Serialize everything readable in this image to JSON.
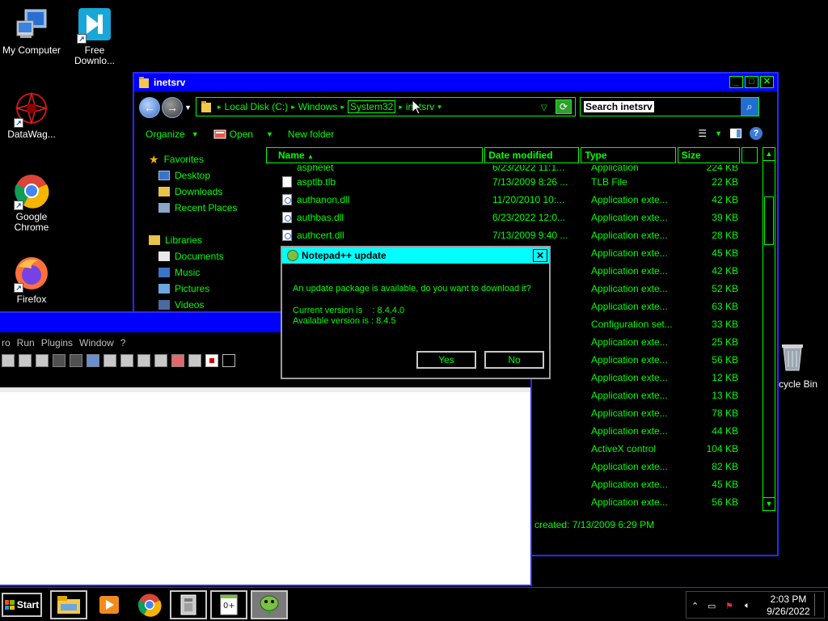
{
  "desktop": {
    "icons": [
      {
        "label": "My Computer"
      },
      {
        "label": "Free Downlo..."
      },
      {
        "label": "DataWag..."
      },
      {
        "label": "Google Chrome"
      },
      {
        "label": "Firefox"
      },
      {
        "label": "cycle Bin"
      }
    ]
  },
  "explorer": {
    "title": "inetsrv",
    "breadcrumbs": [
      "Local Disk (C:)",
      "Windows",
      "System32",
      "inetsrv"
    ],
    "search_placeholder": "Search inetsrv",
    "commands": {
      "organize": "Organize",
      "open": "Open",
      "new_folder": "New folder"
    },
    "nav": {
      "favorites": "Favorites",
      "desktop": "Desktop",
      "downloads": "Downloads",
      "recent": "Recent Places",
      "libraries": "Libraries",
      "documents": "Documents",
      "music": "Music",
      "pictures": "Pictures",
      "videos": "Videos"
    },
    "columns": {
      "name": "Name",
      "date": "Date modified",
      "type": "Type",
      "size": "Size"
    },
    "partial_row": {
      "name": "asphelet",
      "date": "6/23/2022 11:1...",
      "type": "Application",
      "size": "224 KB"
    },
    "files": [
      {
        "name": "asptlb.tlb",
        "date": "7/13/2009 8:26 ...",
        "type": "TLB File",
        "size": "22 KB",
        "icon": "tlb"
      },
      {
        "name": "authanon.dll",
        "date": "11/20/2010 10:...",
        "type": "Application exte...",
        "size": "42 KB",
        "icon": "dll"
      },
      {
        "name": "authbas.dll",
        "date": "6/23/2022 12:0...",
        "type": "Application exte...",
        "size": "39 KB",
        "icon": "dll"
      },
      {
        "name": "authcert.dll",
        "date": "7/13/2009 9:40 ...",
        "type": "Application exte...",
        "size": "28 KB",
        "icon": "dll"
      },
      {
        "name": "",
        "date": "40 ...",
        "type": "Application exte...",
        "size": "45 KB",
        "icon": ""
      },
      {
        "name": "",
        "date": "10:...",
        "type": "Application exte...",
        "size": "42 KB",
        "icon": ""
      },
      {
        "name": "",
        "date": "10:...",
        "type": "Application exte...",
        "size": "52 KB",
        "icon": ""
      },
      {
        "name": "",
        "date": "40 ...",
        "type": "Application exte...",
        "size": "63 KB",
        "icon": ""
      },
      {
        "name": "",
        "date": "59 ...",
        "type": "Configuration set...",
        "size": "33 KB",
        "icon": ""
      },
      {
        "name": "",
        "date": "3:...",
        "type": "Application exte...",
        "size": "25 KB",
        "icon": ""
      },
      {
        "name": "",
        "date": "3:...",
        "type": "Application exte...",
        "size": "56 KB",
        "icon": ""
      },
      {
        "name": "",
        "date": "3:...",
        "type": "Application exte...",
        "size": "12 KB",
        "icon": ""
      },
      {
        "name": "",
        "date": "2 11:3...",
        "type": "Application exte...",
        "size": "13 KB",
        "icon": ""
      },
      {
        "name": "",
        "date": "10 10:...",
        "type": "Application exte...",
        "size": "78 KB",
        "icon": ""
      },
      {
        "name": "",
        "date": "9 9:40 ...",
        "type": "Application exte...",
        "size": "44 KB",
        "icon": ""
      },
      {
        "name": "",
        "date": "9 9:38 ...",
        "type": "ActiveX control",
        "size": "104 KB",
        "icon": ""
      },
      {
        "name": "",
        "date": "9 9:40 ...",
        "type": "Application exte...",
        "size": "82 KB",
        "icon": ""
      },
      {
        "name": "",
        "date": "10 10:...",
        "type": "Application exte...",
        "size": "45 KB",
        "icon": ""
      },
      {
        "name": "",
        "date": "10 10:...",
        "type": "Application exte...",
        "size": "56 KB",
        "icon": ""
      }
    ],
    "status": "created: 7/13/2009 6:29 PM"
  },
  "notepadpp": {
    "menu": [
      "ro",
      "Run",
      "Plugins",
      "Window",
      "?"
    ]
  },
  "dialog": {
    "title": "Notepad++ update",
    "message": "An update package is available, do you want to download it?",
    "current_version": "Current version is    : 8.4.4.0",
    "available_version": "Available version is : 8.4.5",
    "yes": "Yes",
    "no": "No"
  },
  "taskbar": {
    "start": "Start",
    "time": "2:03 PM",
    "date": "9/26/2022"
  },
  "colors": {
    "window_title": "#0000ff",
    "text": "#00ff00",
    "dialog_title": "#00ffff"
  }
}
